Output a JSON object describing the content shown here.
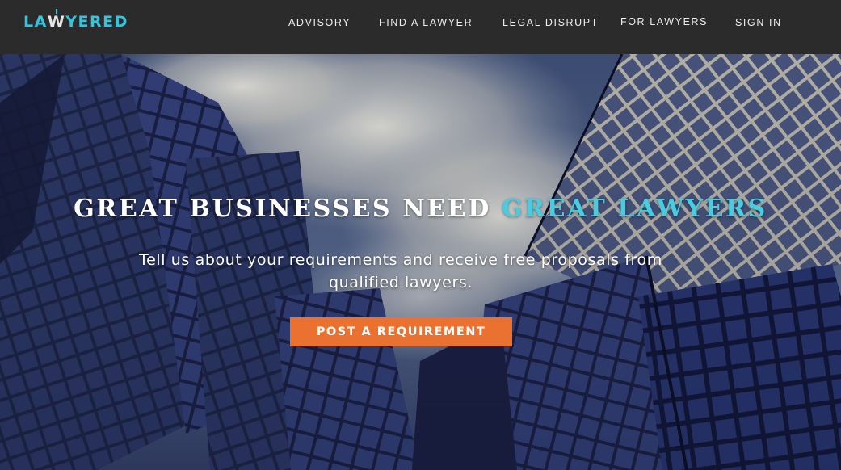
{
  "brand": {
    "logo_parts": [
      "LA",
      "W",
      "YERED"
    ],
    "accent_color": "#35c4dd",
    "cta_color": "#ea7130",
    "nav_bg": "#2b2b2b"
  },
  "nav": {
    "items": [
      {
        "label": "ADVISORY"
      },
      {
        "label": "FIND A LAWYER"
      },
      {
        "label": "LEGAL DISRUPT"
      },
      {
        "label": "FOR LAWYERS"
      },
      {
        "label": "SIGN IN"
      }
    ]
  },
  "hero": {
    "headline_main": "GREAT BUSINESSES NEED ",
    "headline_accent": "GREAT LAWYERS",
    "subtext": "Tell us about your requirements and receive free proposals from qualified lawyers.",
    "cta_label": "POST A REQUIREMENT",
    "background": "glass-skyscrapers-photo"
  }
}
